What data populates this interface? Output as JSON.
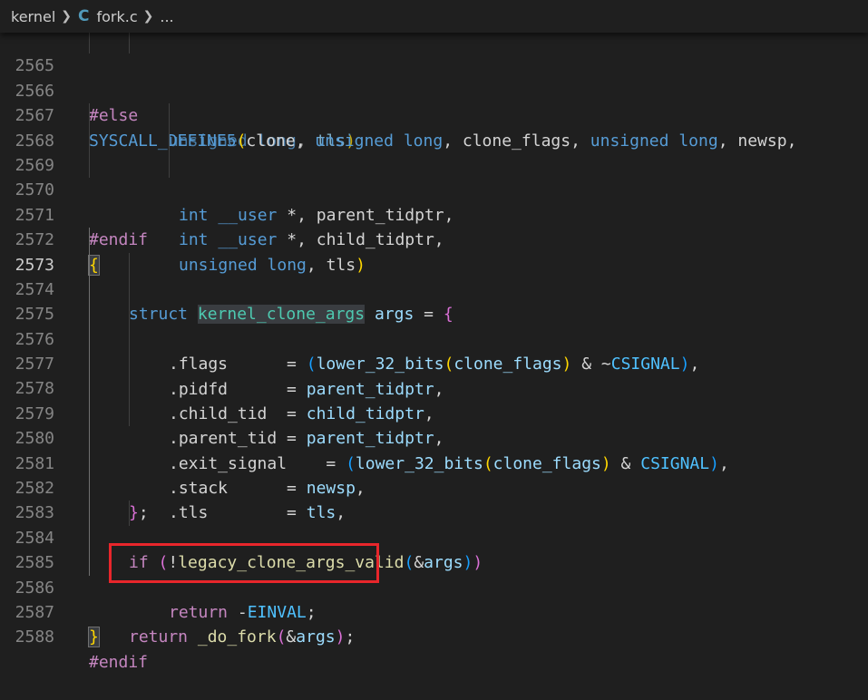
{
  "breadcrumb": {
    "folder": "kernel",
    "file_icon": "C",
    "file": "fork.c",
    "more": "..."
  },
  "lines": [
    {
      "n": "2565",
      "t": [
        "unsigned",
        " ",
        "long",
        ", ",
        "tls",
        ")"
      ]
    },
    {
      "n": "2566",
      "t": [
        "#else"
      ]
    },
    {
      "n": "2567",
      "t": [
        "SYSCALL_DEFINE5",
        "(",
        "clone",
        ", ",
        "unsigned",
        " ",
        "long",
        ", ",
        "clone_flags",
        ", ",
        "unsigned",
        " ",
        "long",
        ", ",
        "newsp",
        ","
      ]
    },
    {
      "n": "2568",
      "t": [
        "int",
        " ",
        "__user",
        " *, ",
        "parent_tidptr",
        ","
      ]
    },
    {
      "n": "2569",
      "t": [
        "int",
        " ",
        "__user",
        " *, ",
        "child_tidptr",
        ","
      ]
    },
    {
      "n": "2570",
      "t": [
        "unsigned",
        " ",
        "long",
        ", ",
        "tls",
        ")"
      ]
    },
    {
      "n": "2571",
      "t": [
        "#endif"
      ]
    },
    {
      "n": "2572",
      "t": [
        "{"
      ]
    },
    {
      "n": "2573",
      "t": [
        "struct",
        " ",
        "kernel_clone_args",
        " ",
        "args",
        " = ",
        "{"
      ]
    },
    {
      "n": "2574",
      "t": [
        ".flags",
        "      = ",
        "(",
        "lower_32_bits",
        "(",
        "clone_flags",
        ")",
        " & ~",
        "CSIGNAL",
        ")",
        ","
      ]
    },
    {
      "n": "2575",
      "t": [
        ".pidfd",
        "      = ",
        "parent_tidptr",
        ","
      ]
    },
    {
      "n": "2576",
      "t": [
        ".child_tid",
        "  = ",
        "child_tidptr",
        ","
      ]
    },
    {
      "n": "2577",
      "t": [
        ".parent_tid",
        " = ",
        "parent_tidptr",
        ","
      ]
    },
    {
      "n": "2578",
      "t": [
        ".exit_signal",
        "    = ",
        "(",
        "lower_32_bits",
        "(",
        "clone_flags",
        ")",
        " & ",
        "CSIGNAL",
        ")",
        ","
      ]
    },
    {
      "n": "2579",
      "t": [
        ".stack",
        "      = ",
        "newsp",
        ","
      ]
    },
    {
      "n": "2580",
      "t": [
        ".tls",
        "        = ",
        "tls",
        ","
      ]
    },
    {
      "n": "2581",
      "t": [
        "}",
        ";"
      ]
    },
    {
      "n": "2582",
      "t": []
    },
    {
      "n": "2583",
      "t": [
        "if",
        " ",
        "(",
        "!",
        "legacy_clone_args_valid",
        "(",
        "&",
        "args",
        ")",
        ")"
      ]
    },
    {
      "n": "2584",
      "t": [
        "return",
        " -",
        "EINVAL",
        ";"
      ]
    },
    {
      "n": "2585",
      "t": []
    },
    {
      "n": "2586",
      "t": [
        "return",
        " ",
        "_do_fork",
        "(",
        "&",
        "args",
        ")",
        ";"
      ]
    },
    {
      "n": "2587",
      "t": [
        "}"
      ]
    },
    {
      "n": "2588",
      "t": [
        "#endif"
      ]
    }
  ],
  "annotation": {
    "color": "#e8262b"
  }
}
